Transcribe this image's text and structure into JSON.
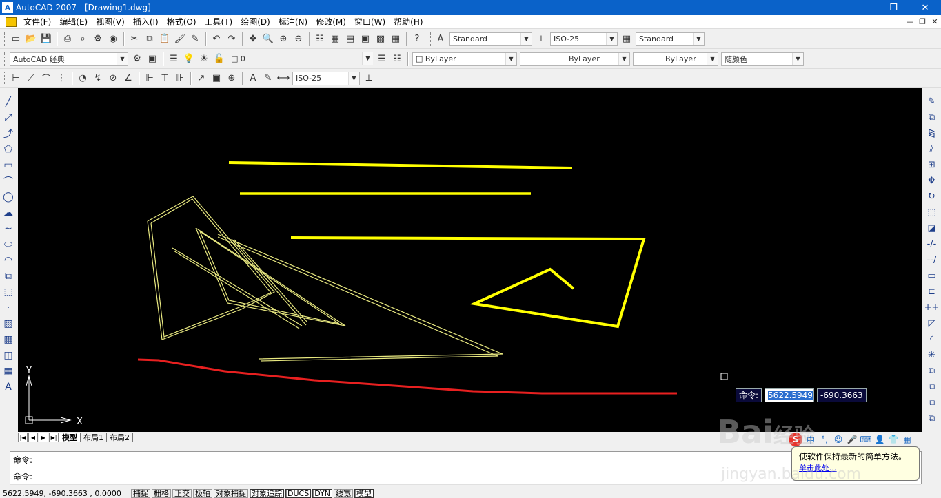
{
  "window": {
    "app_icon": "A",
    "title": "AutoCAD 2007 - [Drawing1.dwg]",
    "minimize_icon": "minimize-icon",
    "restore_icon": "restore-icon",
    "close_icon": "close-icon"
  },
  "menu": {
    "items": [
      "文件(F)",
      "编辑(E)",
      "视图(V)",
      "插入(I)",
      "格式(O)",
      "工具(T)",
      "绘图(D)",
      "标注(N)",
      "修改(M)",
      "窗口(W)",
      "帮助(H)"
    ]
  },
  "toolbar_styles": {
    "text_style": "Standard",
    "dim_style": "ISO-25",
    "table_style": "Standard"
  },
  "toolbar_layers": {
    "workspace": "AutoCAD 经典",
    "layer": "0",
    "color": "ByLayer",
    "linetype": "ByLayer",
    "lineweight": "ByLayer",
    "plot_style": "随颜色"
  },
  "toolbar_dim": {
    "dim_style": "ISO-25"
  },
  "canvas": {
    "background": "#000000",
    "ucs_y_label": "Y",
    "ucs_x_label": "X",
    "dynamic_input_label": "命令:",
    "dynamic_input_x": "5622.5949",
    "dynamic_input_y": "-690.3663"
  },
  "layout_tabs": [
    "模型",
    "布局1",
    "布局2"
  ],
  "command": {
    "line1": "命令:",
    "line2": "命令:"
  },
  "status": {
    "coords": "5622.5949,  -690.3663 ,  0.0000",
    "buttons": [
      "捕捉",
      "栅格",
      "正交",
      "极轴",
      "对象捕捉",
      "对象追踪",
      "DUCS",
      "DYN",
      "线宽",
      "模型"
    ],
    "active_buttons": [
      "对象追踪",
      "DUCS",
      "DYN",
      "模型"
    ]
  },
  "balloon": {
    "text": "使软件保持最新的简单方法。",
    "link": "单击此处..."
  },
  "watermark": {
    "brand": "Bai",
    "brand_suffix": "经验",
    "url": "jingyan.baidu.com"
  },
  "colors": {
    "title_blue": "#0a62c9",
    "yellow": "#ffff00",
    "red": "#e82020",
    "polyline_yellow": "#e8e880"
  }
}
